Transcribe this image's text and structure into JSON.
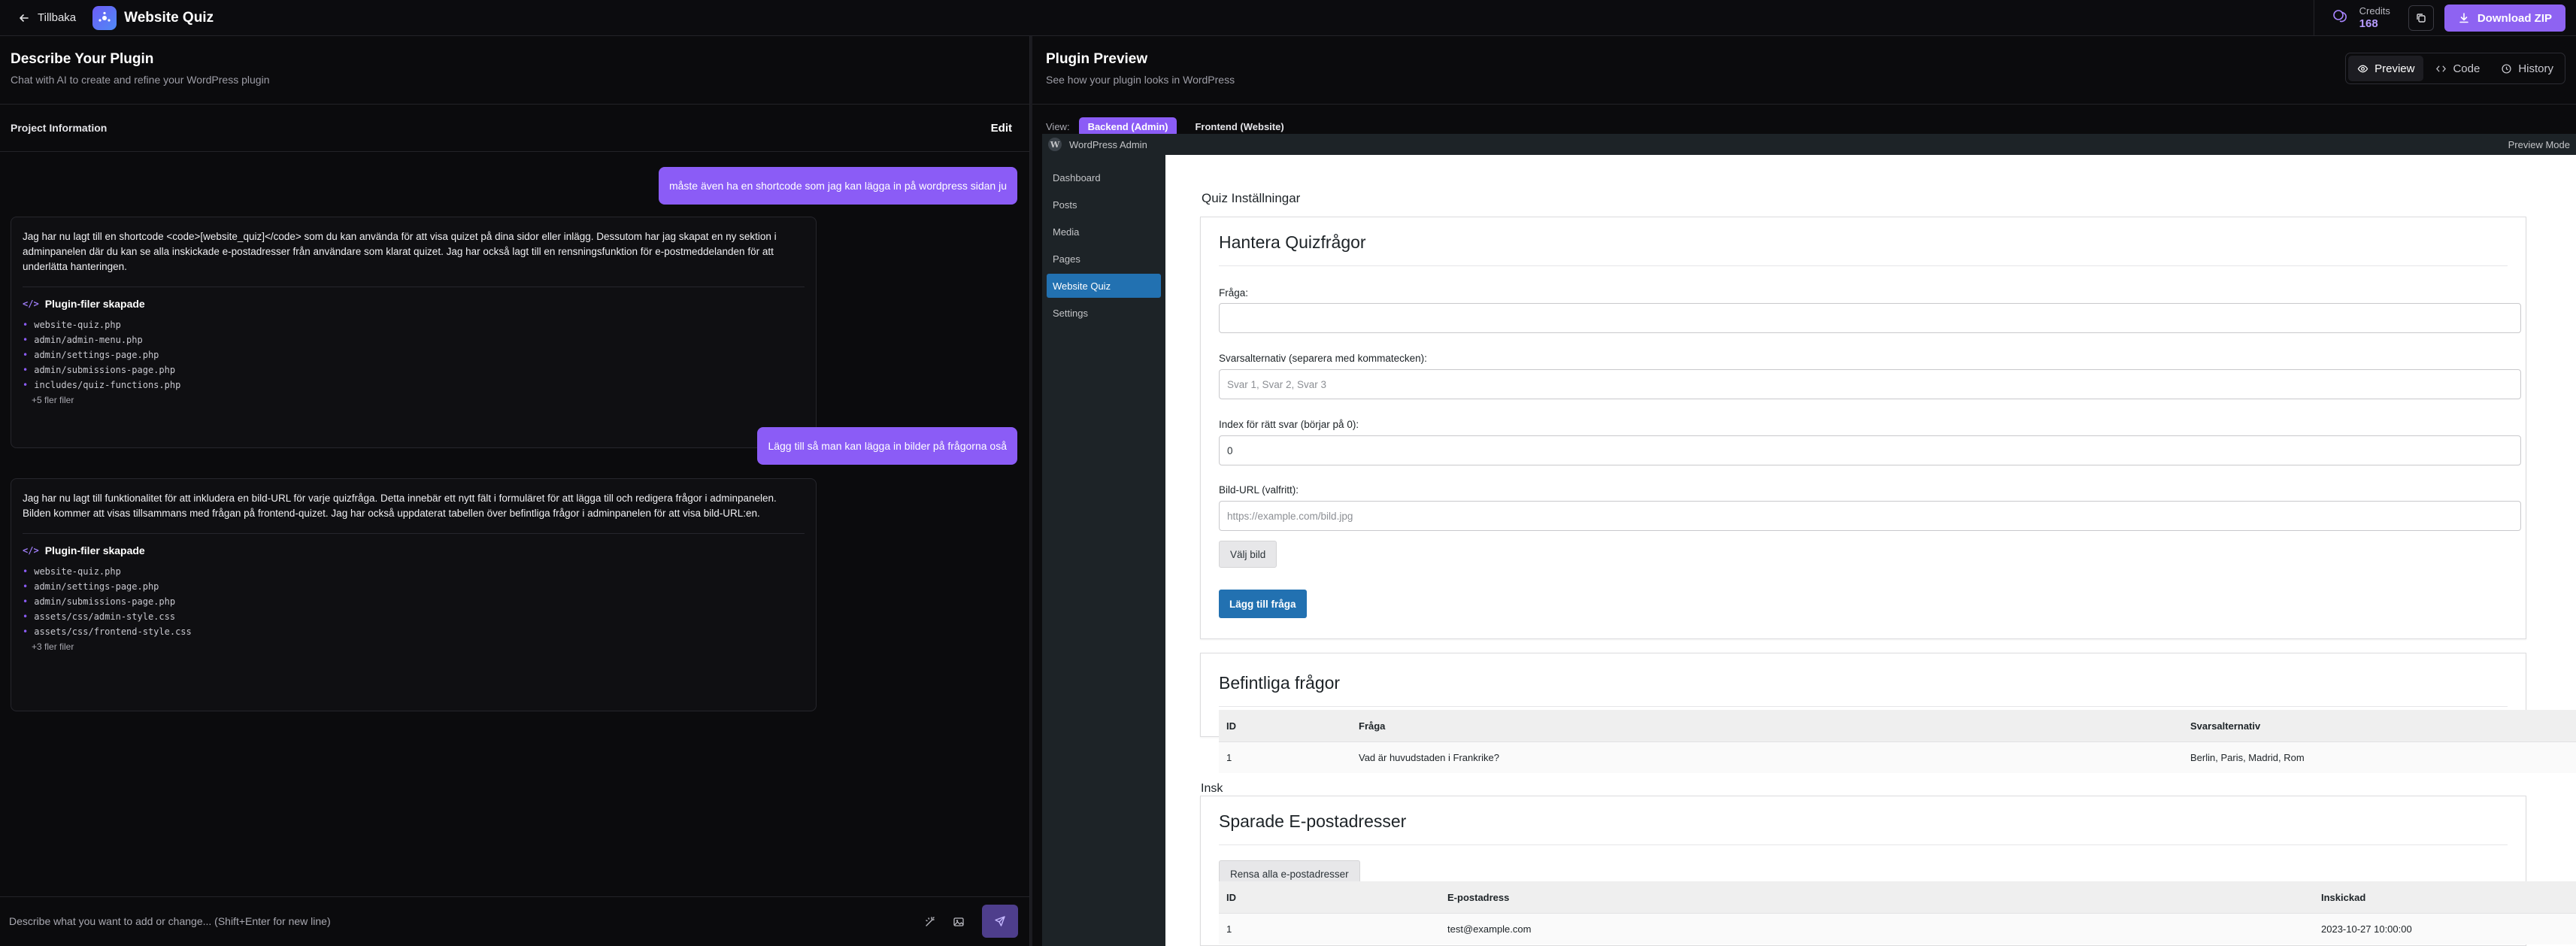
{
  "topbar": {
    "back_label": "Tillbaka",
    "app_title": "Website Quiz",
    "credits_label": "Credits",
    "credits_value": "168",
    "download_label": "Download ZIP"
  },
  "left": {
    "title": "Describe Your Plugin",
    "subtitle": "Chat with AI to create and refine your WordPress plugin",
    "project_info_label": "Project Information",
    "edit_label": "Edit"
  },
  "chat": {
    "messages": [
      {
        "role": "user",
        "text": "måste även ha en shortcode som jag kan lägga in på wordpress sidan ju"
      },
      {
        "role": "assistant",
        "text": "Jag har nu lagt till en shortcode <code>[website_quiz]</code> som du kan använda för att visa quizet på dina sidor eller inlägg. Dessutom har jag skapat en ny sektion i adminpanelen där du kan se alla inskickade e-postadresser från användare som klarat quizet. Jag har också lagt till en rensningsfunktion för e-postmeddelanden för att underlätta hanteringen.",
        "files_title": "Plugin-filer skapade",
        "files": [
          "website-quiz.php",
          "admin/admin-menu.php",
          "admin/settings-page.php",
          "admin/submissions-page.php",
          "includes/quiz-functions.php"
        ],
        "more": "+5 fler filer"
      },
      {
        "role": "user",
        "text": "Lägg till så man kan lägga in bilder på frågorna oså"
      },
      {
        "role": "assistant",
        "text": "Jag har nu lagt till funktionalitet för att inkludera en bild-URL för varje quizfråga. Detta innebär ett nytt fält i formuläret för att lägga till och redigera frågor i adminpanelen. Bilden kommer att visas tillsammans med frågan på frontend-quizet. Jag har också uppdaterat tabellen över befintliga frågor i adminpanelen för att visa bild-URL:en.",
        "files_title": "Plugin-filer skapade",
        "files": [
          "website-quiz.php",
          "admin/settings-page.php",
          "admin/submissions-page.php",
          "assets/css/admin-style.css",
          "assets/css/frontend-style.css"
        ],
        "more": "+3 fler filer"
      }
    ],
    "composer_placeholder": "Describe what you want to add or change... (Shift+Enter for new line)"
  },
  "right": {
    "title": "Plugin Preview",
    "subtitle": "See how your plugin looks in WordPress",
    "tabs": [
      "Preview",
      "Code",
      "History"
    ],
    "view_label": "View:",
    "view_backend": "Backend (Admin)",
    "view_frontend": "Frontend (Website)"
  },
  "wp": {
    "bar_title": "WordPress Admin",
    "bar_right": "Preview Mode",
    "logo_letter": "W",
    "menu": [
      "Dashboard",
      "Posts",
      "Media",
      "Pages",
      "Website Quiz",
      "Settings"
    ],
    "page_title": "Quiz Inställningar",
    "manage_title": "Hantera Quizfrågor",
    "q_label": "Fråga:",
    "q_value": "",
    "opts_label": "Svarsalternativ (separera med kommatecken):",
    "opts_placeholder": "Svar 1, Svar 2, Svar 3",
    "idx_label": "Index för rätt svar (börjar på 0):",
    "idx_value": "0",
    "img_label": "Bild-URL (valfritt):",
    "img_placeholder": "https://example.com/bild.jpg",
    "choose_img": "Välj bild",
    "add_btn": "Lägg till fråga",
    "existing_title": "Befintliga frågor",
    "q_table": {
      "headers": [
        "ID",
        "Fråga",
        "Svarsalternativ"
      ],
      "rows": [
        [
          "1",
          "Vad är huvudstaden i Frankrike?",
          "Berlin, Paris, Madrid, Rom"
        ]
      ]
    },
    "insk_fragment": "Insk",
    "emails_title": "Sparade E-postadresser",
    "clear_btn": "Rensa alla e-postadresser",
    "email_table": {
      "headers": [
        "ID",
        "E-postadress",
        "Inskickad"
      ],
      "rows": [
        [
          "1",
          "test@example.com",
          "2023-10-27 10:00:00"
        ]
      ]
    }
  }
}
